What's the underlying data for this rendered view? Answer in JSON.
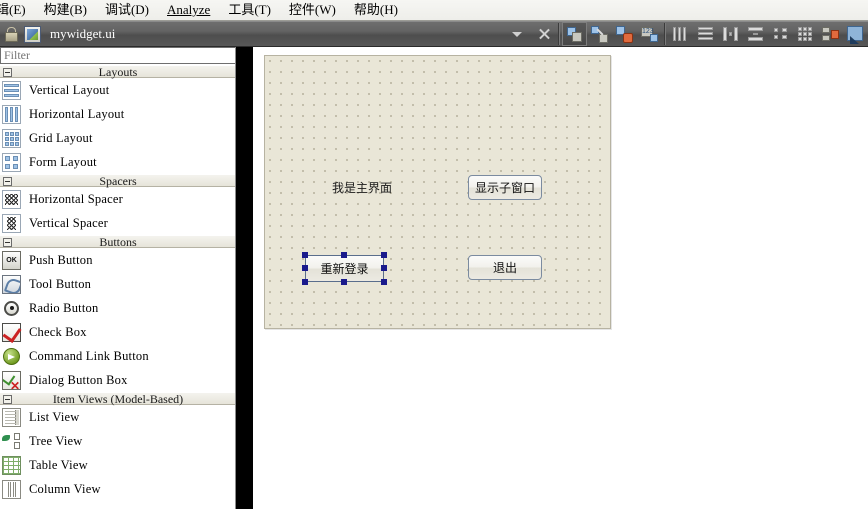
{
  "menubar": {
    "items": [
      {
        "label": "辑(E)",
        "mnemonic": "E",
        "name": "menu-edit"
      },
      {
        "label": "构建(B)",
        "mnemonic": "B",
        "name": "menu-build"
      },
      {
        "label": "调试(D)",
        "mnemonic": "D",
        "name": "menu-debug"
      },
      {
        "label": "Analyze",
        "mnemonic": "A",
        "name": "menu-analyze"
      },
      {
        "label": "工具(T)",
        "mnemonic": "T",
        "name": "menu-tools"
      },
      {
        "label": "控件(W)",
        "mnemonic": "W",
        "name": "menu-widgets"
      },
      {
        "label": "帮助(H)",
        "mnemonic": "H",
        "name": "menu-help"
      }
    ]
  },
  "toolbar": {
    "lock_icon": "lock-icon",
    "file_icon": "ui-file-icon",
    "filename": "mywidget.ui",
    "dropdown_icon": "chevron-down-icon",
    "close_icon": "close-icon",
    "buttons": [
      {
        "name": "edit-widgets-button",
        "icon": "edit-widgets-icon"
      },
      {
        "name": "edit-signals-slots-button",
        "icon": "edit-signals-slots-icon"
      },
      {
        "name": "edit-buddies-button",
        "icon": "edit-buddies-icon"
      },
      {
        "name": "edit-tab-order-button",
        "icon": "edit-tab-order-icon"
      },
      {
        "name": "layout-horizontally-button",
        "icon": "layout-horizontal-icon"
      },
      {
        "name": "layout-vertically-button",
        "icon": "layout-vertical-icon"
      },
      {
        "name": "layout-splitter-horizontal-button",
        "icon": "splitter-horizontal-icon"
      },
      {
        "name": "layout-splitter-vertical-button",
        "icon": "splitter-vertical-icon"
      },
      {
        "name": "layout-form-button",
        "icon": "form-layout-icon"
      },
      {
        "name": "layout-grid-button",
        "icon": "grid-layout-icon"
      },
      {
        "name": "break-layout-button",
        "icon": "break-layout-icon"
      },
      {
        "name": "adjust-size-button",
        "icon": "adjust-size-icon"
      }
    ]
  },
  "widgetbox": {
    "filter_placeholder": "Filter",
    "filter_value": "",
    "groups": [
      {
        "title": "Layouts",
        "name": "group-layouts",
        "items": [
          {
            "label": "Vertical Layout",
            "icon": "vertical-layout-icon"
          },
          {
            "label": "Horizontal Layout",
            "icon": "horizontal-layout-icon"
          },
          {
            "label": "Grid Layout",
            "icon": "grid-layout-icon"
          },
          {
            "label": "Form Layout",
            "icon": "form-layout-icon"
          }
        ]
      },
      {
        "title": "Spacers",
        "name": "group-spacers",
        "items": [
          {
            "label": "Horizontal Spacer",
            "icon": "horizontal-spacer-icon"
          },
          {
            "label": "Vertical Spacer",
            "icon": "vertical-spacer-icon"
          }
        ]
      },
      {
        "title": "Buttons",
        "name": "group-buttons",
        "items": [
          {
            "label": "Push Button",
            "icon": "push-button-icon"
          },
          {
            "label": "Tool Button",
            "icon": "tool-button-icon"
          },
          {
            "label": "Radio Button",
            "icon": "radio-button-icon"
          },
          {
            "label": "Check Box",
            "icon": "check-box-icon"
          },
          {
            "label": "Command Link Button",
            "icon": "command-link-button-icon"
          },
          {
            "label": "Dialog Button Box",
            "icon": "dialog-button-box-icon"
          }
        ]
      },
      {
        "title": "Item Views (Model-Based)",
        "name": "group-item-views",
        "items": [
          {
            "label": "List View",
            "icon": "list-view-icon"
          },
          {
            "label": "Tree View",
            "icon": "tree-view-icon"
          },
          {
            "label": "Table View",
            "icon": "table-view-icon"
          },
          {
            "label": "Column View",
            "icon": "column-view-icon"
          }
        ]
      }
    ]
  },
  "form": {
    "label_text": "我是主界面",
    "buttons": [
      {
        "name": "show-child-window-button",
        "label": "显示子窗口",
        "selected": false
      },
      {
        "name": "relogin-button",
        "label": "重新登录",
        "selected": true
      },
      {
        "name": "exit-button",
        "label": "退出",
        "selected": false
      }
    ],
    "selection_handle_color": "#1a1a8c",
    "canvas_color": "#e9e6d7",
    "grid_dot_color": "#b9b4a0"
  }
}
